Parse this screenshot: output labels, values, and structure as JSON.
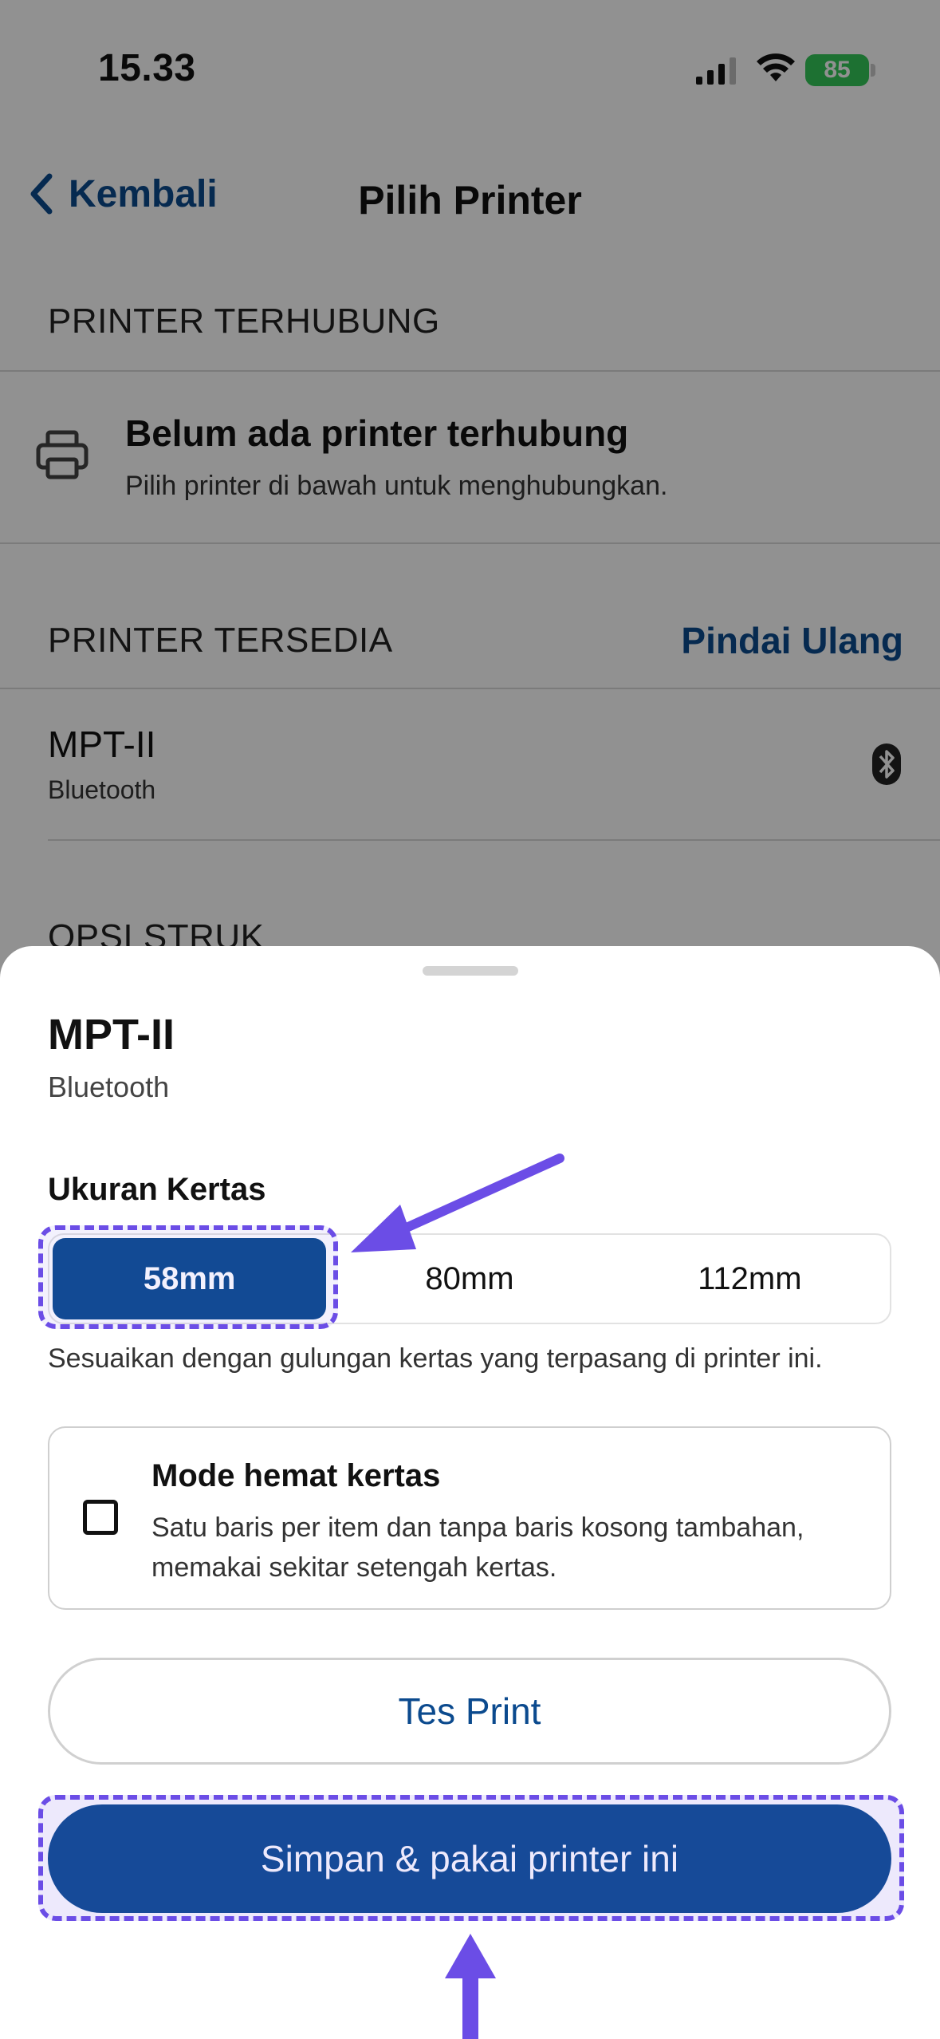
{
  "status_bar": {
    "time": "15.33",
    "battery": "85"
  },
  "nav": {
    "back_label": "Kembali",
    "title": "Pilih Printer"
  },
  "connected": {
    "section_label": "PRINTER TERHUBUNG",
    "title": "Belum ada printer terhubung",
    "subtitle": "Pilih printer di bawah untuk menghubungkan."
  },
  "available": {
    "section_label": "PRINTER TERSEDIA",
    "rescan_label": "Pindai Ulang",
    "devices": [
      {
        "name": "MPT-II",
        "type": "Bluetooth"
      }
    ]
  },
  "receipt_options": {
    "section_label": "OPSI STRUK"
  },
  "sheet": {
    "title": "MPT-II",
    "subtitle": "Bluetooth",
    "paper_label": "Ukuran Kertas",
    "paper_options": [
      "58mm",
      "80mm",
      "112mm"
    ],
    "paper_selected": "58mm",
    "paper_hint": "Sesuaikan dengan gulungan kertas yang terpasang di printer ini.",
    "saver_title": "Mode hemat kertas",
    "saver_desc": "Satu baris per item dan tanpa baris kosong tambahan, memakai sekitar setengah kertas.",
    "saver_checked": false,
    "test_label": "Tes Print",
    "save_label": "Simpan & pakai printer ini"
  },
  "colors": {
    "primary": "#0b4a8e",
    "annotation": "#6b4de6"
  }
}
